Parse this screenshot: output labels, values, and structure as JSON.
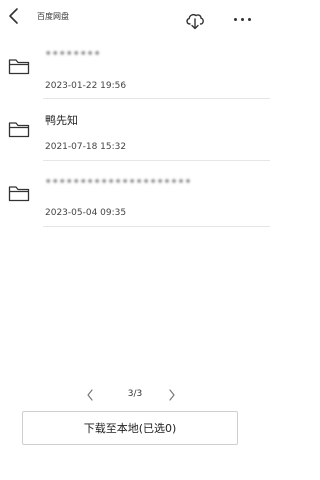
{
  "header": {
    "title": "百度网盘",
    "back_icon": "chevron-left-icon",
    "cloud_icon": "cloud-download-icon",
    "more_icon": "more-horizontal-icon"
  },
  "files": [
    {
      "name": "••••••••",
      "time": "2023-01-22 19:56",
      "icon": "folder-icon"
    },
    {
      "name": "鸭先知",
      "time": "2021-07-18 15:32",
      "icon": "folder-icon"
    },
    {
      "name": "•••••••••••••••••••••",
      "time": "2023-05-04 09:35",
      "icon": "folder-icon"
    }
  ],
  "pagination": {
    "label": "3/3",
    "prev_icon": "chevron-left-icon",
    "next_icon": "chevron-right-icon"
  },
  "download_button": {
    "label": "下载至本地(已选0)"
  },
  "colors": {
    "text": "#222222",
    "divider": "#e6e6e6",
    "button_border": "#cfcfcf"
  }
}
